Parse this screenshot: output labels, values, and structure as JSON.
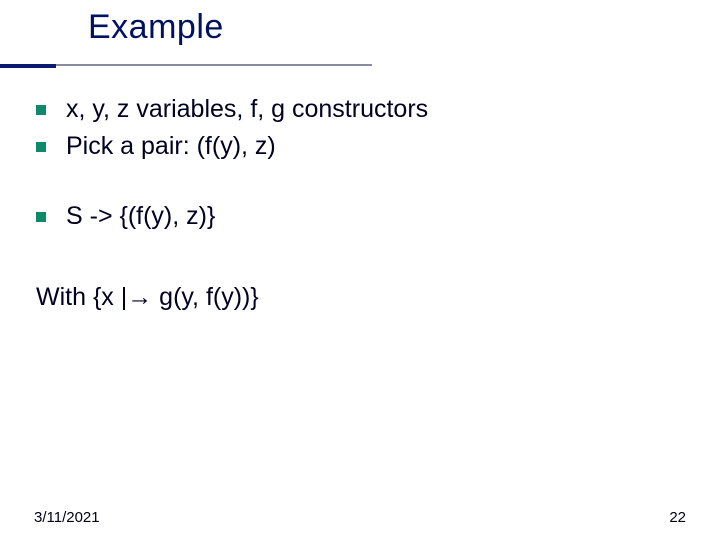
{
  "slide": {
    "title": "Example",
    "bullets": [
      "x, y, z variables, f, g constructors",
      "Pick a pair: (f(y), z)",
      "S -> {(f(y), z)}"
    ],
    "with_line": "With {x |→ g(y, f(y))}",
    "footer_date": "3/11/2021",
    "footer_page": "22"
  }
}
